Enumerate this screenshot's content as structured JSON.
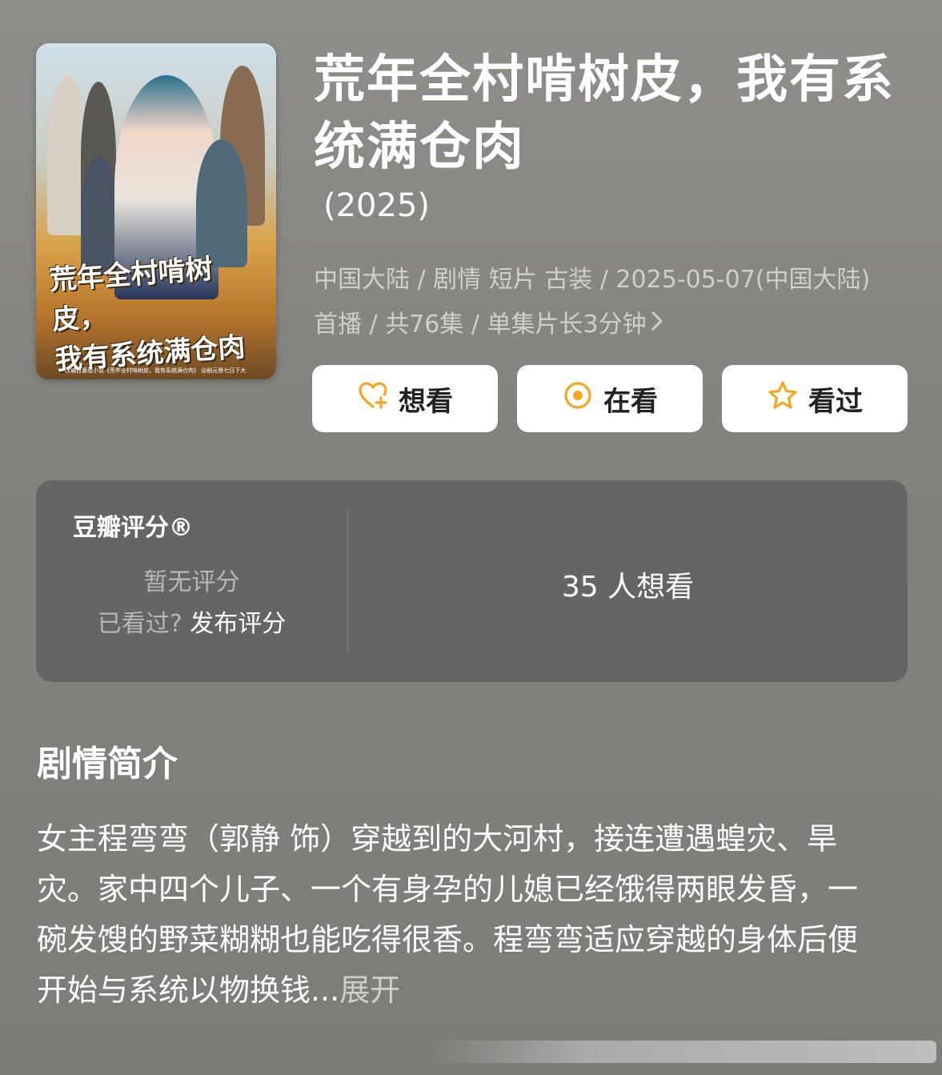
{
  "poster": {
    "title_art": "荒年全村啃树皮，\n我有系统满仓肉",
    "credit": "改编自番茄小说《荒年全村啃树皮，我有系统满仓肉》 @剧元景七日下大"
  },
  "header": {
    "title": "荒年全村啃树皮，我有系统满仓肉",
    "year": "(2025)",
    "meta": "中国大陆 / 剧情 短片 古装 / 2025-05-07(中国大陆) 首播 / 共76集 / 单集片长3分钟"
  },
  "actions": {
    "want": "想看",
    "watching": "在看",
    "watched": "看过"
  },
  "rating": {
    "label": "豆瓣评分®",
    "no_rating": "暂无评分",
    "seen_prompt": "已看过?",
    "rate_link": "发布评分",
    "want_count": "35 人想看"
  },
  "synopsis": {
    "title": "剧情简介",
    "text": "女主程弯弯（郭静 饰）穿越到的大河村，接连遭遇蝗灾、旱灾。家中四个儿子、一个有身孕的儿媳已经饿得两眼发昏，一碗发馊的野菜糊糊也能吃得很香。程弯弯适应穿越的身体后便开始与系统以物换钱...",
    "expand": "展开"
  },
  "colors": {
    "accent": "#f5a623",
    "background": "#868683",
    "card": "#656564"
  }
}
